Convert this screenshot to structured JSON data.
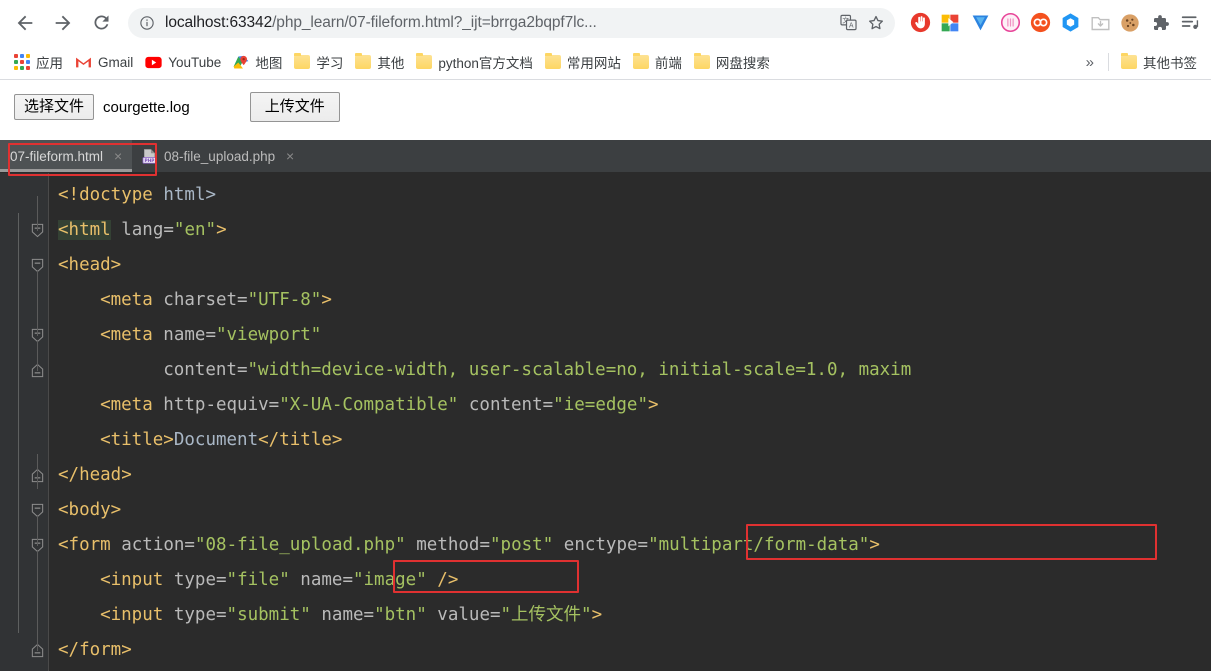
{
  "browser": {
    "nav": {
      "back_label": "Back",
      "forward_label": "Forward",
      "reload_label": "Reload"
    },
    "omnibox": {
      "info_icon": "info-circle-icon",
      "url_host": "localhost:63342",
      "url_path": "/php_learn/07-fileform.html?_ijt=brrga2bqpf7lc...",
      "translate_icon": "translate-icon",
      "bookmark_icon": "star-icon"
    },
    "extensions": [
      {
        "name": "adblock-icon",
        "color": "#e8392c"
      },
      {
        "name": "color-squares-icon",
        "color": "#4285f4"
      },
      {
        "name": "v-badge-icon",
        "color": "#2b83e0"
      },
      {
        "name": "pink-circle-icon",
        "color": "#e8469a"
      },
      {
        "name": "infinity-icon",
        "color": "#f4511e"
      },
      {
        "name": "hexagon-icon",
        "color": "#2196f3"
      },
      {
        "name": "download-folder-icon",
        "color": "#c6c6c6"
      },
      {
        "name": "cookie-icon",
        "color": "#d9a066"
      },
      {
        "name": "puzzle-piece-icon",
        "color": "#5f6368"
      },
      {
        "name": "menu-list-icon",
        "color": "#5f6368"
      }
    ],
    "bookmarks": {
      "apps_label": "应用",
      "items": [
        {
          "label": "Gmail",
          "icon": "gmail-icon"
        },
        {
          "label": "YouTube",
          "icon": "youtube-icon"
        },
        {
          "label": "地图",
          "icon": "maps-icon"
        },
        {
          "label": "学习",
          "icon": "folder-icon"
        },
        {
          "label": "其他",
          "icon": "folder-icon"
        },
        {
          "label": "python官方文档",
          "icon": "folder-icon"
        },
        {
          "label": "常用网站",
          "icon": "folder-icon"
        },
        {
          "label": "前端",
          "icon": "folder-icon"
        },
        {
          "label": "网盘搜索",
          "icon": "folder-icon"
        }
      ],
      "overflow_label": "»",
      "other_bookmarks_label": "其他书签"
    }
  },
  "page": {
    "choose_file_label": "选择文件",
    "selected_file_name": "courgette.log",
    "submit_label": "上传文件"
  },
  "ide": {
    "tabs": [
      {
        "label": "07-fileform.html",
        "icon": "html-file-icon",
        "close": "×",
        "active": true
      },
      {
        "label": "08-file_upload.php",
        "icon": "php-file-icon",
        "close": "×",
        "active": false
      }
    ],
    "annotations": [
      {
        "name": "active-tab-highlight"
      },
      {
        "name": "enctype-highlight"
      },
      {
        "name": "name-image-highlight"
      }
    ],
    "code_lines": [
      {
        "indent": 1,
        "fold": "none",
        "tokens": [
          {
            "text": "<!doctype ",
            "cls": "t-tag"
          },
          {
            "text": "html>",
            "cls": "t-text"
          }
        ]
      },
      {
        "indent": 1,
        "fold": "open",
        "tokens": [
          {
            "text": "<html",
            "cls": "hl-word"
          },
          {
            "text": " ",
            "cls": "t-plain"
          },
          {
            "text": "lang=",
            "cls": "t-attr"
          },
          {
            "text": "\"en\"",
            "cls": "t-val"
          },
          {
            "text": ">",
            "cls": "t-tag"
          }
        ]
      },
      {
        "indent": 1,
        "fold": "open",
        "tokens": [
          {
            "text": "<head>",
            "cls": "t-tag"
          }
        ]
      },
      {
        "indent": 5,
        "fold": "none",
        "tokens": [
          {
            "text": "<meta ",
            "cls": "t-tag"
          },
          {
            "text": "charset=",
            "cls": "t-attr"
          },
          {
            "text": "\"UTF-8\"",
            "cls": "t-val"
          },
          {
            "text": ">",
            "cls": "t-tag"
          }
        ]
      },
      {
        "indent": 5,
        "fold": "open",
        "tokens": [
          {
            "text": "<meta ",
            "cls": "t-tag"
          },
          {
            "text": "name=",
            "cls": "t-attr"
          },
          {
            "text": "\"viewport\"",
            "cls": "t-val"
          }
        ]
      },
      {
        "indent": 11,
        "fold": "close",
        "tokens": [
          {
            "text": "content=",
            "cls": "t-attr"
          },
          {
            "text": "\"width=device-width, user-scalable=no, initial-scale=1.0, maxim",
            "cls": "t-val"
          }
        ]
      },
      {
        "indent": 5,
        "fold": "none",
        "tokens": [
          {
            "text": "<meta ",
            "cls": "t-tag"
          },
          {
            "text": "http-equiv=",
            "cls": "t-attr"
          },
          {
            "text": "\"X-UA-Compatible\"",
            "cls": "t-val"
          },
          {
            "text": " ",
            "cls": "t-plain"
          },
          {
            "text": "content=",
            "cls": "t-attr"
          },
          {
            "text": "\"ie=edge\"",
            "cls": "t-val"
          },
          {
            "text": ">",
            "cls": "t-tag"
          }
        ]
      },
      {
        "indent": 5,
        "fold": "none",
        "tokens": [
          {
            "text": "<title>",
            "cls": "t-tag"
          },
          {
            "text": "Document",
            "cls": "t-text"
          },
          {
            "text": "</title>",
            "cls": "t-tag"
          }
        ]
      },
      {
        "indent": 1,
        "fold": "close",
        "tokens": [
          {
            "text": "</head>",
            "cls": "t-tag"
          }
        ]
      },
      {
        "indent": 1,
        "fold": "open",
        "tokens": [
          {
            "text": "<body>",
            "cls": "t-tag"
          }
        ]
      },
      {
        "indent": 1,
        "fold": "open",
        "tokens": [
          {
            "text": "<form ",
            "cls": "t-tag"
          },
          {
            "text": "action=",
            "cls": "t-attr"
          },
          {
            "text": "\"08-file_upload.php\"",
            "cls": "t-val"
          },
          {
            "text": " ",
            "cls": "t-plain"
          },
          {
            "text": "method=",
            "cls": "t-attr"
          },
          {
            "text": "\"post\"",
            "cls": "t-val"
          },
          {
            "text": " ",
            "cls": "t-plain"
          },
          {
            "text": "enctype=",
            "cls": "t-attr"
          },
          {
            "text": "\"multipart/form-data\"",
            "cls": "t-val"
          },
          {
            "text": ">",
            "cls": "t-tag"
          }
        ]
      },
      {
        "indent": 5,
        "fold": "none",
        "tokens": [
          {
            "text": "<input ",
            "cls": "t-tag"
          },
          {
            "text": "type=",
            "cls": "t-attr"
          },
          {
            "text": "\"file\"",
            "cls": "t-val"
          },
          {
            "text": " ",
            "cls": "t-plain"
          },
          {
            "text": "name=",
            "cls": "t-attr"
          },
          {
            "text": "\"image\"",
            "cls": "t-val"
          },
          {
            "text": " />",
            "cls": "t-tag"
          }
        ]
      },
      {
        "indent": 5,
        "fold": "none",
        "tokens": [
          {
            "text": "<input ",
            "cls": "t-tag"
          },
          {
            "text": "type=",
            "cls": "t-attr"
          },
          {
            "text": "\"submit\"",
            "cls": "t-val"
          },
          {
            "text": " ",
            "cls": "t-plain"
          },
          {
            "text": "name=",
            "cls": "t-attr"
          },
          {
            "text": "\"btn\"",
            "cls": "t-val"
          },
          {
            "text": " ",
            "cls": "t-plain"
          },
          {
            "text": "value=",
            "cls": "t-attr"
          },
          {
            "text": "\"上传文件\"",
            "cls": "t-val"
          },
          {
            "text": ">",
            "cls": "t-tag"
          }
        ]
      },
      {
        "indent": 1,
        "fold": "close",
        "tokens": [
          {
            "text": "</form>",
            "cls": "t-tag"
          }
        ]
      }
    ]
  }
}
